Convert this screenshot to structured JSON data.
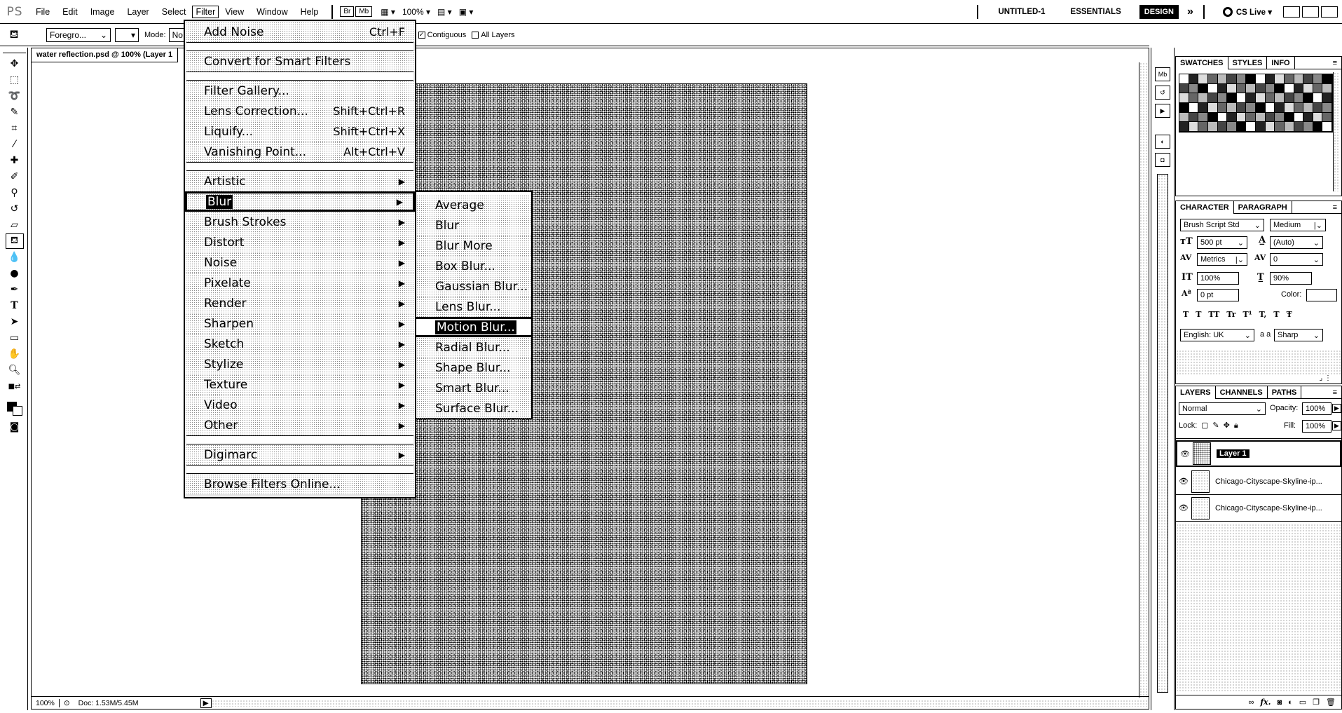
{
  "menubar": {
    "logo": "PS",
    "items": [
      "File",
      "Edit",
      "Image",
      "Layer",
      "Select",
      "Filter",
      "View",
      "Window",
      "Help"
    ],
    "zoom": "100%",
    "mb_label": "Mb",
    "workspace": {
      "doc_name": "UNTITLED-1",
      "essentials": "ESSENTIALS",
      "design": "DESIGN",
      "more": "»",
      "cslive": "CS Live ▾"
    }
  },
  "optbar": {
    "fill_source": "Foregro...",
    "mode_label": "Mode:",
    "mode_value": "No",
    "contiguous": "Contiguous",
    "all_layers": "All Layers"
  },
  "document": {
    "tab_title": "water reflection.psd @ 100% (Layer 1",
    "status_zoom": "100%",
    "status_doc": "Doc: 1.53M/5.45M"
  },
  "filter_menu": {
    "groups": [
      [
        {
          "label": "Add Noise",
          "shortcut": "Ctrl+F"
        }
      ],
      [
        {
          "label": "Convert for Smart Filters",
          "shortcut": ""
        }
      ],
      [
        {
          "label": "Filter Gallery...",
          "shortcut": ""
        },
        {
          "label": "Lens Correction...",
          "shortcut": "Shift+Ctrl+R"
        },
        {
          "label": "Liquify...",
          "shortcut": "Shift+Ctrl+X"
        },
        {
          "label": "Vanishing Point...",
          "shortcut": "Alt+Ctrl+V"
        }
      ],
      [
        {
          "label": "Artistic",
          "submenu": true
        },
        {
          "label": "Blur",
          "submenu": true,
          "highlighted": true
        },
        {
          "label": "Brush Strokes",
          "submenu": true
        },
        {
          "label": "Distort",
          "submenu": true
        },
        {
          "label": "Noise",
          "submenu": true
        },
        {
          "label": "Pixelate",
          "submenu": true
        },
        {
          "label": "Render",
          "submenu": true
        },
        {
          "label": "Sharpen",
          "submenu": true
        },
        {
          "label": "Sketch",
          "submenu": true
        },
        {
          "label": "Stylize",
          "submenu": true
        },
        {
          "label": "Texture",
          "submenu": true
        },
        {
          "label": "Video",
          "submenu": true
        },
        {
          "label": "Other",
          "submenu": true
        }
      ],
      [
        {
          "label": "Digimarc",
          "submenu": true
        }
      ],
      [
        {
          "label": "Browse Filters Online...",
          "shortcut": ""
        }
      ]
    ]
  },
  "blur_submenu": {
    "items": [
      "Average",
      "Blur",
      "Blur More",
      "Box Blur...",
      "Gaussian Blur...",
      "Lens Blur...",
      "Motion Blur...",
      "Radial Blur...",
      "Shape Blur...",
      "Smart Blur...",
      "Surface Blur..."
    ],
    "highlighted_index": 6
  },
  "swatches_panel": {
    "tabs": [
      "SWATCHES",
      "STYLES",
      "INFO"
    ]
  },
  "character_panel": {
    "tabs": [
      "CHARACTER",
      "PARAGRAPH"
    ],
    "font_family": "Brush Script Std",
    "font_style": "Medium",
    "font_size": "500 pt",
    "leading": "(Auto)",
    "kerning": "Metrics",
    "tracking": "0",
    "vertical_scale": "100%",
    "horizontal_scale": "90%",
    "baseline_shift": "0 pt",
    "color_label": "Color:",
    "language": "English: UK",
    "aa_label": "a a",
    "antialias": "Sharp",
    "style_buttons": [
      "T",
      "T",
      "TT",
      "Tr",
      "T¹",
      "T,",
      "T",
      "Ŧ"
    ]
  },
  "layers_panel": {
    "tabs": [
      "LAYERS",
      "CHANNELS",
      "PATHS"
    ],
    "blend_mode": "Normal",
    "opacity_label": "Opacity:",
    "opacity": "100%",
    "lock_label": "Lock:",
    "fill_label": "Fill:",
    "fill": "100%",
    "layers": [
      {
        "name": "Layer 1",
        "selected": true
      },
      {
        "name": "Chicago-Cityscape-Skyline-ip...",
        "selected": false
      },
      {
        "name": "Chicago-Cityscape-Skyline-ip...",
        "selected": false
      }
    ],
    "footer_icons": [
      "link-icon",
      "fx-icon",
      "mask-icon",
      "adjustment-icon",
      "folder-icon",
      "new-layer-icon",
      "trash-icon"
    ]
  }
}
